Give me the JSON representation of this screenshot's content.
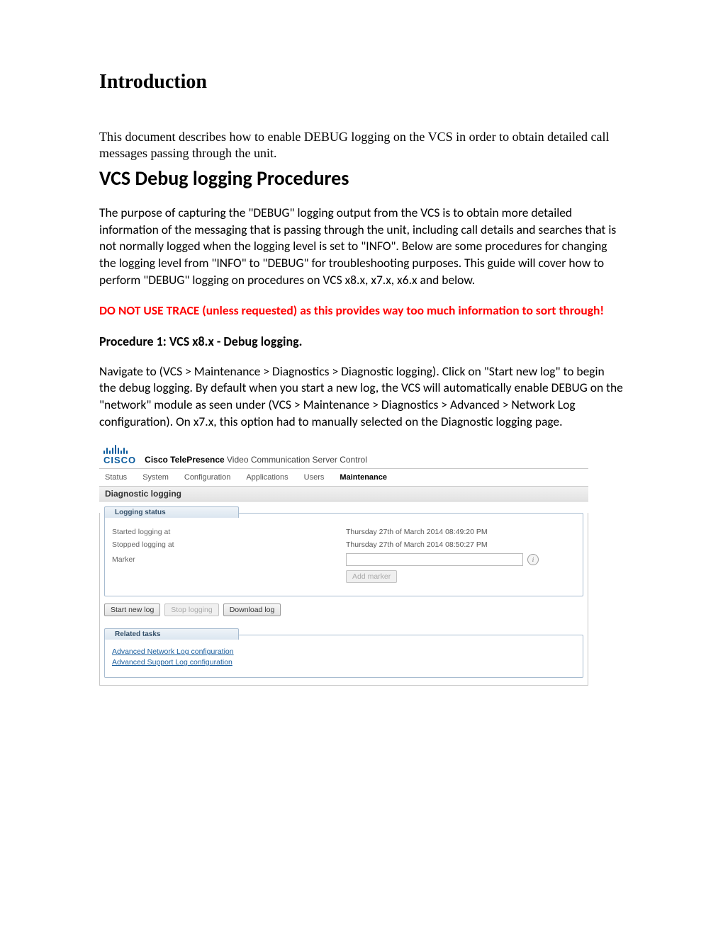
{
  "doc": {
    "h1": "Introduction",
    "intro_para": "This document describes how to enable DEBUG logging on the VCS in order to obtain detailed call messages passing through the unit.",
    "h2": "VCS Debug logging Procedures",
    "purpose_para": "The purpose of capturing the \"DEBUG\" logging output from the VCS is to obtain more detailed information of the messaging that is passing through the unit, including call details and searches that is not normally logged when the logging level is set to \"INFO\". Below are some procedures for changing the logging level from \"INFO\" to \"DEBUG\" for troubleshooting purposes. This guide will cover how to perform \"DEBUG\" logging on procedures on VCS x8.x, x7.x, x6.x and below.",
    "warning": "DO NOT USE TRACE (unless requested) as this provides way too much information to sort through!",
    "proc1_heading": "Procedure 1: VCS x8.x - Debug logging.",
    "proc1_para": "Navigate to (VCS > Maintenance > Diagnostics > Diagnostic logging). Click on \"Start new log\" to begin the debug logging. By default when you start a new log, the VCS will automatically enable DEBUG on the \"network\" module as seen under (VCS > Maintenance > Diagnostics > Advanced > Network Log configuration). On x7.x, this option had to manually selected on the Diagnostic logging page."
  },
  "shot": {
    "brand_word": "CISCO",
    "brand_title_bold": "Cisco TelePresence",
    "brand_title_rest": " Video Communication Server Control",
    "tabs": {
      "status": "Status",
      "system": "System",
      "configuration": "Configuration",
      "applications": "Applications",
      "users": "Users",
      "maintenance": "Maintenance"
    },
    "section_title": "Diagnostic logging",
    "group_logging_status": "Logging status",
    "labels": {
      "started": "Started logging at",
      "stopped": "Stopped logging at",
      "marker": "Marker"
    },
    "values": {
      "started": "Thursday 27th of March 2014 08:49:20 PM",
      "stopped": "Thursday 27th of March 2014 08:50:27 PM"
    },
    "buttons": {
      "add_marker": "Add marker",
      "start_new_log": "Start new log",
      "stop_logging": "Stop logging",
      "download_log": "Download log"
    },
    "group_related": "Related tasks",
    "links": {
      "adv_network": "Advanced Network Log configuration",
      "adv_support": "Advanced Support Log configuration"
    },
    "info_glyph": "i"
  }
}
